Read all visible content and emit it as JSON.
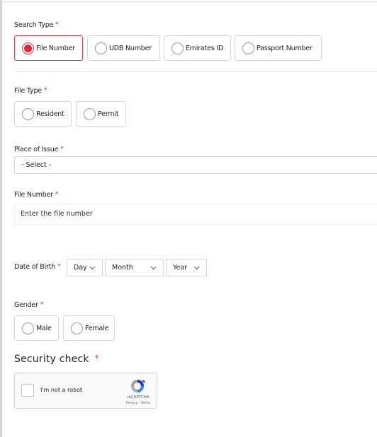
{
  "search_type": {
    "label": "Search Type",
    "required_mark": "*",
    "options": [
      {
        "label": "File Number",
        "selected": true
      },
      {
        "label": "UDB Number",
        "selected": false
      },
      {
        "label": "Emirates ID",
        "selected": false
      },
      {
        "label": "Passport Number",
        "selected": false
      }
    ]
  },
  "file_type": {
    "label": "File Type",
    "required_mark": "*",
    "options": [
      {
        "label": "Resident",
        "selected": false
      },
      {
        "label": "Permit",
        "selected": false
      }
    ]
  },
  "place_of_issue": {
    "label": "Place of Issue",
    "required_mark": "*",
    "value": "- Select -"
  },
  "file_number": {
    "label": "File Number",
    "required_mark": "*",
    "placeholder": "Enter the file number"
  },
  "date_of_birth": {
    "label": "Date of Birth",
    "required_mark": "*",
    "day": "Day",
    "month": "Month",
    "year": "Year"
  },
  "gender": {
    "label": "Gender",
    "required_mark": "*",
    "options": [
      {
        "label": "Male",
        "selected": false
      },
      {
        "label": "Female",
        "selected": false
      }
    ]
  },
  "security_check": {
    "title": "Security check",
    "required_mark": "*",
    "captcha": {
      "checkbox_label": "I'm not a robot",
      "brand": "reCAPTCHA",
      "links": "Privacy - Terms"
    }
  },
  "colors": {
    "accent": "#e0283c",
    "required": "#d0202f",
    "border": "#d6d6d6"
  }
}
